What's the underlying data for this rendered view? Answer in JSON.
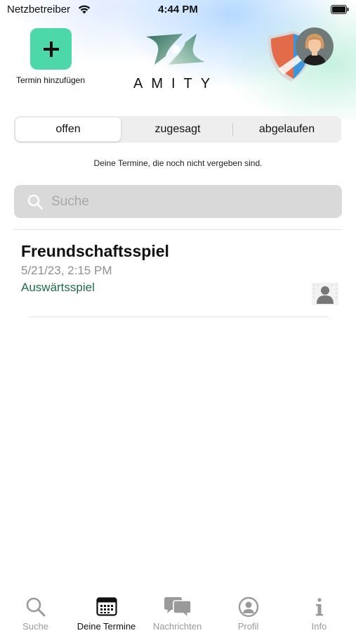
{
  "status_bar": {
    "carrier": "Netzbetreiber",
    "time": "4:44 PM"
  },
  "header": {
    "add_label": "Termin hinzufügen",
    "brand": "AMITY",
    "accent_color": "#4cd8a8"
  },
  "segments": {
    "items": [
      "offen",
      "zugesagt",
      "abgelaufen"
    ],
    "selected": "offen"
  },
  "subtitle": "Deine Termine, die noch nicht vergeben sind.",
  "search": {
    "placeholder": "Suche",
    "value": ""
  },
  "events": [
    {
      "title": "Freundschaftsspiel",
      "date": "5/21/23, 2:15 PM",
      "type": "Auswärtsspiel",
      "type_color": "#1f6c4a"
    }
  ],
  "tabbar": {
    "items": [
      {
        "label": "Suche",
        "icon": "search-icon"
      },
      {
        "label": "Deine Termine",
        "icon": "calendar-icon"
      },
      {
        "label": "Nachrichten",
        "icon": "chat-icon"
      },
      {
        "label": "Profil",
        "icon": "profile-icon"
      },
      {
        "label": "Info",
        "icon": "info-icon"
      }
    ],
    "selected": "Deine Termine"
  }
}
